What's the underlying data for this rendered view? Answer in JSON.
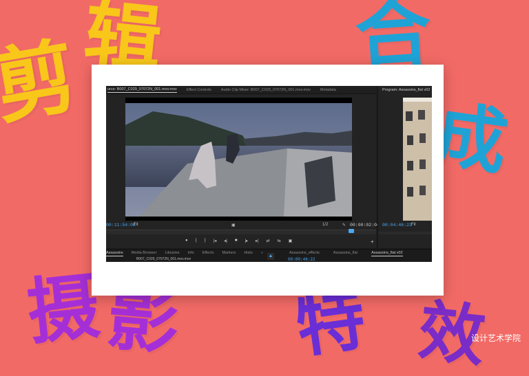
{
  "decor": {
    "chars": [
      "剪",
      "辑",
      "合",
      "成",
      "摄",
      "影",
      "特",
      "效"
    ],
    "watermark": "设计艺术学院"
  },
  "source_monitor": {
    "tabs": [
      "urce: B007_C029_07072N_001.mov.mov",
      "Effect Controls",
      "Audio Clip Mixer: B007_C029_07072N_001.mov.mov",
      "Metadata"
    ],
    "timecode_left": "00:11:54:08",
    "fit": "Fit",
    "fraction": "1/2",
    "timecode_right": "00:00:02:04"
  },
  "program_monitor": {
    "title": "Program: Assassins_flat v02",
    "timecode": "00:04:46:22",
    "fit": "Fit"
  },
  "transport": {
    "buttons": [
      "●",
      "{",
      "}",
      "|◂",
      "◂|",
      "■",
      "|▸",
      "▸|",
      "⇄",
      "⇆",
      "▣"
    ],
    "add": "+"
  },
  "project_panel": {
    "tabs": [
      "Assassins",
      "Media Browser",
      "Libraries",
      "Info",
      "Effects",
      "Markers",
      "Histo"
    ],
    "overflow": "»",
    "clip": "B007_C029_07072N_001.mov.mov"
  },
  "timeline_panel": {
    "tabs": [
      "Assassins_effects",
      "Assassins_flat",
      "Assassins_flat v02"
    ],
    "timecode": "00:00:46:22"
  },
  "colors": {
    "accent": "#4ba8f0",
    "background": "#f26a66"
  }
}
